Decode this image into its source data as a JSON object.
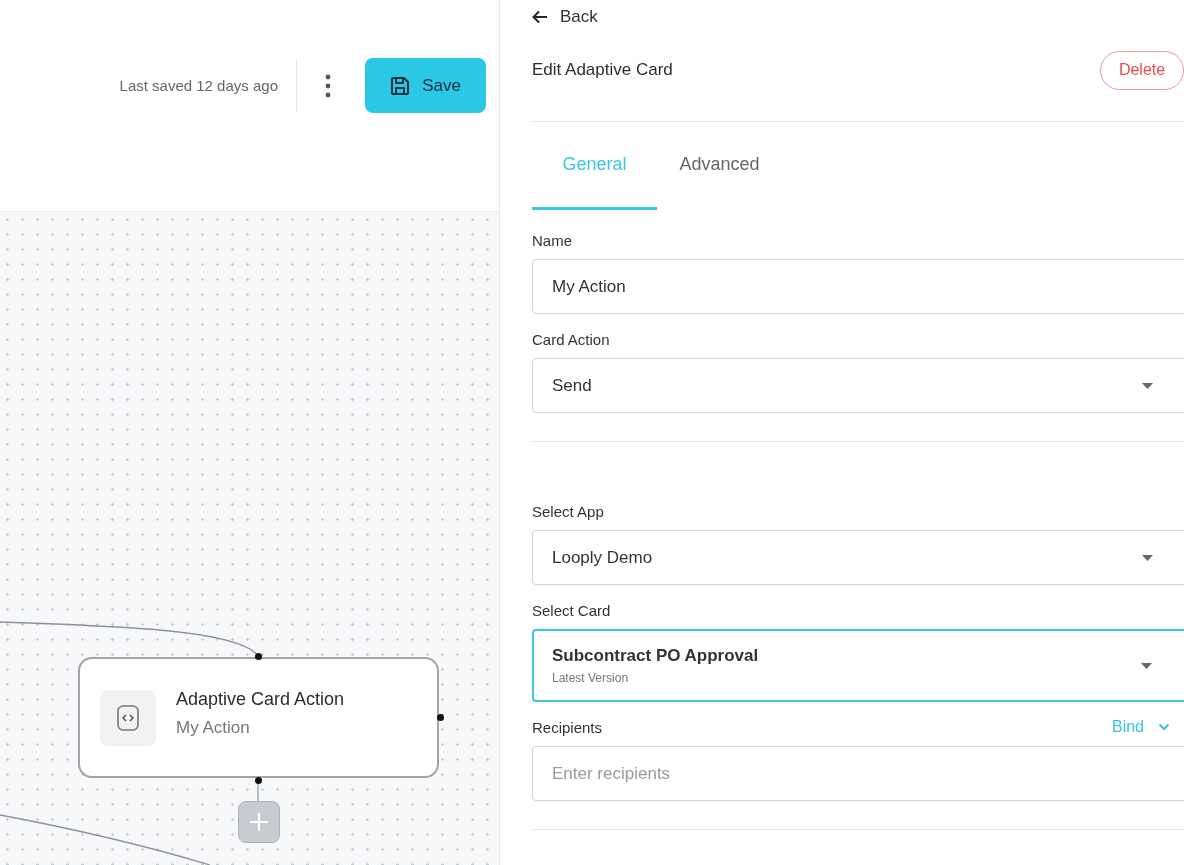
{
  "toolbar": {
    "last_saved": "Last saved 12 days ago",
    "save_button": "Save"
  },
  "canvas": {
    "node": {
      "title": "Adaptive Card Action",
      "subtitle": "My Action"
    }
  },
  "panel": {
    "back": "Back",
    "title": "Edit Adaptive Card",
    "delete_button": "Delete",
    "tabs": [
      {
        "label": "General",
        "selected": true
      },
      {
        "label": "Advanced",
        "selected": false
      }
    ],
    "sections": [
      {
        "fields": [
          {
            "kind": "text",
            "label": "Name",
            "value": "My Action",
            "focused": false
          },
          {
            "kind": "select",
            "label": "Card Action",
            "value": "Send",
            "focused": false
          }
        ]
      },
      {
        "fields": [
          {
            "kind": "select",
            "label": "Select App",
            "value": "Looply Demo",
            "focused": false
          },
          {
            "kind": "select",
            "label": "Select Card",
            "value": "Subcontract PO Approval",
            "caption": "Latest Version",
            "focused": true
          },
          {
            "kind": "text",
            "label": "Recipients",
            "placeholder": "Enter recipients",
            "bind": "Bind",
            "focused": false
          }
        ]
      }
    ]
  }
}
